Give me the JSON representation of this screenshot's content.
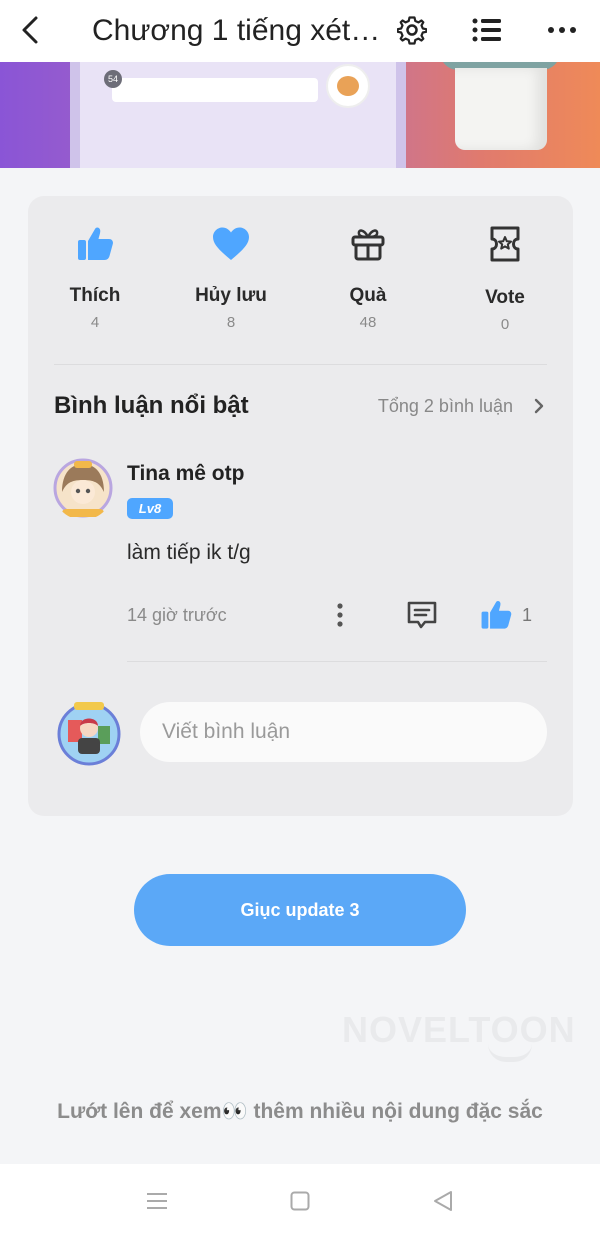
{
  "header": {
    "title": "Chương 1 tiếng xét ...",
    "icons": {
      "back": "chevron-left-icon",
      "settings": "gear-icon",
      "toc": "list-icon",
      "more": "more-horizontal-icon"
    }
  },
  "banner": {
    "badge": "54"
  },
  "actions": [
    {
      "icon": "thumbs-up-icon",
      "label": "Thích",
      "count": "4"
    },
    {
      "icon": "heart-icon",
      "label": "Hủy lưu",
      "count": "8"
    },
    {
      "icon": "gift-icon",
      "label": "Quà",
      "count": "48"
    },
    {
      "icon": "vote-ticket-icon",
      "label": "Vote",
      "count": "0"
    }
  ],
  "comments_section": {
    "title": "Bình luận nổi bật",
    "total": "Tổng 2 bình luận",
    "comment": {
      "user": "Tina mê otp",
      "level": "Lv8",
      "text": "làm tiếp ik t/g",
      "time": "14 giờ trước",
      "likes": "1"
    },
    "input_placeholder": "Viết bình luận"
  },
  "urge_button": "Giục update 3",
  "watermark": "NOVELTOON",
  "footer_hint": "Lướt lên để xem👀 thêm nhiều nội dung đặc sắc",
  "colors": {
    "accent": "#5ba8f7",
    "like": "#4fa6ff",
    "level_badge": "#4fa6ff"
  }
}
